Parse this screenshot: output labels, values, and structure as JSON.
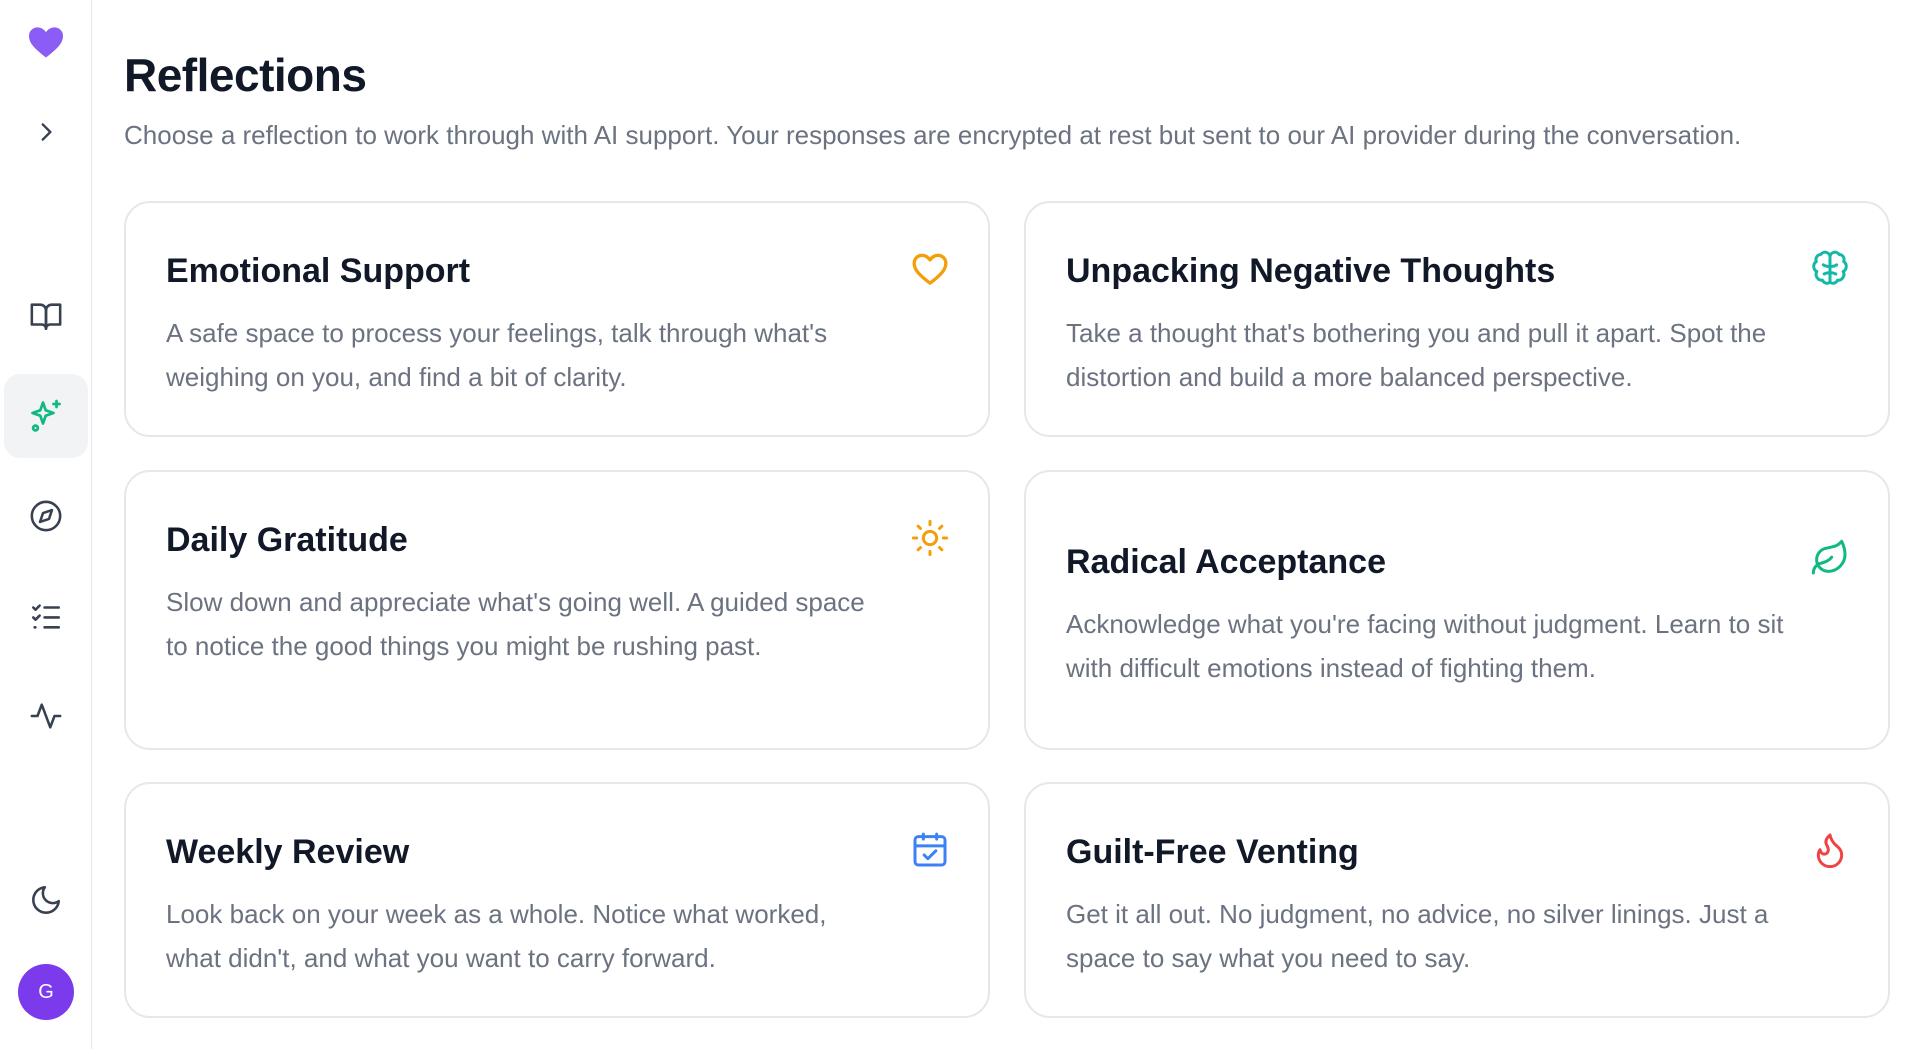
{
  "sidebar": {
    "logo_icon": "heart-icon",
    "logo_color": "#8b5cf6",
    "expand_icon": "chevron-right-icon",
    "nav_items": [
      {
        "icon": "book-open-icon",
        "active": false
      },
      {
        "icon": "sparkles-icon",
        "active": true,
        "color": "#10b981"
      },
      {
        "icon": "compass-icon",
        "active": false
      },
      {
        "icon": "checklist-icon",
        "active": false
      },
      {
        "icon": "activity-icon",
        "active": false
      }
    ],
    "theme_icon": "moon-icon",
    "avatar": {
      "initial": "G",
      "color": "#7c3aed"
    }
  },
  "header": {
    "title": "Reflections",
    "subtitle": "Choose a reflection to work through with AI support. Your responses are encrypted at rest but sent to our AI provider during the conversation."
  },
  "cards": [
    {
      "title": "Emotional Support",
      "description": "A safe space to process your feelings, talk through what's weighing on you, and find a bit of clarity.",
      "icon": "heart-outline-icon",
      "icon_color": "#f59e0b"
    },
    {
      "title": "Unpacking Negative Thoughts",
      "description": "Take a thought that's bothering you and pull it apart. Spot the distortion and build a more balanced perspective.",
      "icon": "brain-icon",
      "icon_color": "#14b8a6"
    },
    {
      "title": "Daily Gratitude",
      "description": "Slow down and appreciate what's going well. A guided space to notice the good things you might be rushing past.",
      "icon": "sun-icon",
      "icon_color": "#f59e0b"
    },
    {
      "title": "Radical Acceptance",
      "description": "Acknowledge what you're facing without judgment. Learn to sit with difficult emotions instead of fighting them.",
      "icon": "leaf-icon",
      "icon_color": "#10b981"
    },
    {
      "title": "Weekly Review",
      "description": "Look back on your week as a whole. Notice what worked, what didn't, and what you want to carry forward.",
      "icon": "calendar-check-icon",
      "icon_color": "#3b82f6"
    },
    {
      "title": "Guilt-Free Venting",
      "description": "Get it all out. No judgment, no advice, no silver linings. Just a space to say what you need to say.",
      "icon": "flame-icon",
      "icon_color": "#ef4444"
    }
  ]
}
